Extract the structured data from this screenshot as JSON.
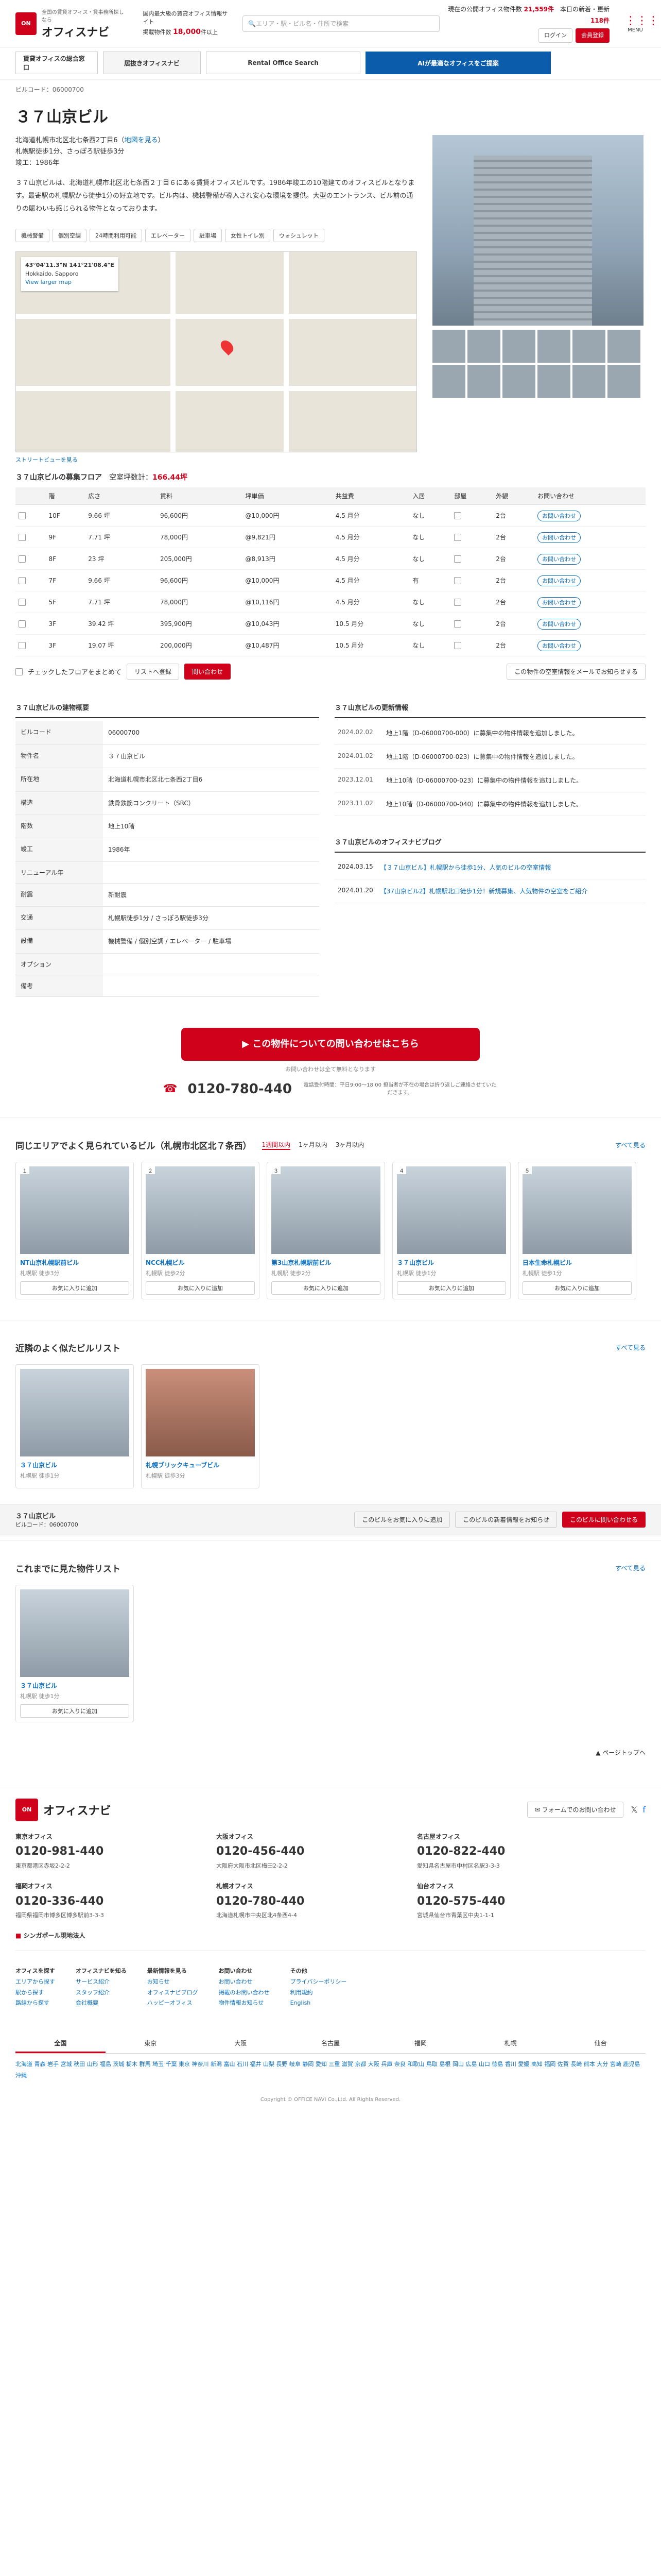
{
  "header": {
    "logo_sub": "全国の賃貸オフィス・貸事務所探しなら",
    "logo": "オフィスナビ",
    "tag1": "国内最大級の賃貸オフィス情報サイト",
    "tag2": "掲載物件数",
    "count": "18,000",
    "count_unit": "件以上",
    "search_ph": "エリア・駅・ビル名・住所で検索",
    "r1": "現在の公開オフィス物件数",
    "r1v": "21,559件",
    "r2": "本日の新着・更新",
    "r2v": "118件",
    "login": "ログイン",
    "register": "会員登録",
    "menu": "MENU"
  },
  "banners": [
    "賃貸オフィスの総合窓口",
    "居抜きオフィスナビ",
    "Rental Office Search",
    "AIが最適なオフィスをご提案"
  ],
  "crumb": "ビルコード：06000700",
  "title": "３７山京ビル",
  "addr": [
    "北海道札幌市北区北七条西2丁目6",
    "札幌駅徒歩1分、さっぽろ駅徒歩3分",
    "竣工：1986年"
  ],
  "addr_link": "地図を見る",
  "desc": "３７山京ビルは、北海道札幌市北区北七条西２丁目６にある賃貸オフィスビルです。1986年竣工の10階建てのオフィスビルとなります。最寄駅の札幌駅から徒歩1分の好立地です。ビル内は、機械警備が導入され安心な環境を提供。大型のエントランス、ビル前の通りの賑わいも感じられる物件となっております。",
  "tags": [
    "機械警備",
    "個別空調",
    "24時間利用可能",
    "エレベーター",
    "駐車場",
    "女性トイレ別",
    "ウォシュレット"
  ],
  "map": {
    "coords": "43°04'11.3\"N 141°21'08.4\"E",
    "place": "Hokkaido, Sapporo",
    "link": "View larger map",
    "note": "ストリートビューを見る"
  },
  "avail": {
    "title": "３７山京ビルの募集フロア",
    "total_label": "空室坪数計：",
    "total": "166.44坪",
    "cols": [
      "",
      "階",
      "広さ",
      "賃料",
      "坪単価",
      "共益費",
      "入居",
      "部屋",
      "外観",
      "お問い合わせ"
    ],
    "rows": [
      [
        "10F",
        "9.66 坪",
        "96,600円",
        "@10,000円",
        "4.5 月分",
        "なし",
        "2台",
        "お問い合わせ"
      ],
      [
        "9F",
        "7.71 坪",
        "78,000円",
        "@9,821円",
        "4.5 月分",
        "なし",
        "2台",
        "お問い合わせ"
      ],
      [
        "8F",
        "23 坪",
        "205,000円",
        "@8,913円",
        "4.5 月分",
        "なし",
        "2台",
        "お問い合わせ"
      ],
      [
        "7F",
        "9.66 坪",
        "96,600円",
        "@10,000円",
        "4.5 月分",
        "有",
        "2台",
        "お問い合わせ"
      ],
      [
        "5F",
        "7.71 坪",
        "78,000円",
        "@10,116円",
        "4.5 月分",
        "なし",
        "2台",
        "お問い合わせ"
      ],
      [
        "3F",
        "39.42 坪",
        "395,900円",
        "@10,043円",
        "10.5 月分",
        "なし",
        "2台",
        "お問い合わせ"
      ],
      [
        "3F",
        "19.07 坪",
        "200,000円",
        "@10,487円",
        "10.5 月分",
        "なし",
        "2台",
        "お問い合わせ"
      ]
    ]
  },
  "actions": {
    "check": "チェックしたフロアをまとめて",
    "btn1": "リストへ登録",
    "btn2": "問い合わせ",
    "right": "この物件の空室情報をメールでお知らせする"
  },
  "detail": {
    "title": "３７山京ビルの建物概要",
    "rows": [
      [
        "ビルコード",
        "06000700"
      ],
      [
        "物件名",
        "３７山京ビル"
      ],
      [
        "所在地",
        "北海道札幌市北区北七条西2丁目6"
      ],
      [
        "構造",
        "鉄骨鉄筋コンクリート（SRC）"
      ],
      [
        "階数",
        "地上10階"
      ],
      [
        "竣工",
        "1986年"
      ],
      [
        "リニューアル年",
        ""
      ],
      [
        "耐震",
        "新耐震"
      ],
      [
        "交通",
        "札幌駅徒歩1分 / さっぽろ駅徒歩3分"
      ],
      [
        "設備",
        "機械警備 / 個別空調 / エレベーター / 駐車場"
      ],
      [
        "オプション",
        ""
      ],
      [
        "備考",
        ""
      ]
    ]
  },
  "history": {
    "title": "３７山京ビルの更新情報",
    "rows": [
      [
        "2024.02.02",
        "地上1階（D-06000700-000）に募集中の物件情報を追加しました。"
      ],
      [
        "2024.01.02",
        "地上1階（D-06000700-023）に募集中の物件情報を追加しました。"
      ],
      [
        "2023.12.01",
        "地上10階（D-06000700-023）に募集中の物件情報を追加しました。"
      ],
      [
        "2023.11.02",
        "地上10階（D-06000700-040）に募集中の物件情報を追加しました。"
      ]
    ]
  },
  "blog": {
    "title": "３７山京ビルのオフィスナビブログ",
    "rows": [
      [
        "2024.03.15",
        "【３７山京ビル】札幌駅から徒歩1分、人気のビルの空室情報"
      ],
      [
        "2024.01.20",
        "【37山京ビル2】札幌駅北口徒歩1分！新規募集、人気物件の空室をご紹介"
      ]
    ]
  },
  "cta": {
    "btn": "この物件についての問い合わせはこちら",
    "note": "お問い合わせは全て無料となります",
    "tel": "0120-780-440",
    "tel_note": "電話受付時間：平日9:00〜18:00 担当者が不在の場合は折り返しご連絡させていただきます。"
  },
  "nearby": {
    "title": "同じエリアでよく見られているビル（札幌市北区北７条西）",
    "tabs": [
      "1週間以内",
      "1ヶ月以内",
      "3ヶ月以内"
    ],
    "see": "すべて見る",
    "cards": [
      [
        "１",
        "NT山京札幌駅前ビル",
        "札幌駅 徒歩3分"
      ],
      [
        "２",
        "NCC札幌ビル",
        "札幌駅 徒歩2分"
      ],
      [
        "３",
        "第3山京札幌駅前ビル",
        "札幌駅 徒歩2分"
      ],
      [
        "４",
        "３７山京ビル",
        "札幌駅 徒歩1分"
      ],
      [
        "５",
        "日本生命札幌ビル",
        "札幌駅 徒歩1分"
      ]
    ],
    "btn": "お気に入りに追加"
  },
  "similar": {
    "title": "近隣のよく似たビルリスト",
    "see": "すべて見る",
    "cards": [
      [
        "３７山京ビル",
        "札幌駅 徒歩1分"
      ],
      [
        "札幌ブリックキューブビル",
        "札幌駅 徒歩3分"
      ]
    ]
  },
  "stickybar": {
    "name": "３７山京ビル",
    "code": "ビルコード：06000700",
    "b1": "このビルをお気に入りに追加",
    "b2": "このビルの新着情報をお知らせ",
    "b3": "このビルに問い合わせる"
  },
  "recent": {
    "title": "これまでに見た物件リスト",
    "see": "すべて見る",
    "card": [
      "３７山京ビル",
      "札幌駅 徒歩1分"
    ],
    "btn": "お気に入りに追加"
  },
  "pagetop": "ページトップへ",
  "footer_form": "フォームでのお問い合わせ",
  "offices": [
    [
      "東京オフィス",
      "0120-981-440",
      "東京都港区赤坂2-2-2"
    ],
    [
      "大阪オフィス",
      "0120-456-440",
      "大阪府大阪市北区梅田2-2-2"
    ],
    [
      "名古屋オフィス",
      "0120-822-440",
      "愛知県名古屋市中村区名駅3-3-3"
    ],
    [
      "福岡オフィス",
      "0120-336-440",
      "福岡県福岡市博多区博多駅前3-3-3"
    ],
    [
      "札幌オフィス",
      "0120-780-440",
      "北海道札幌市中央区北4条西4-4"
    ],
    [
      "仙台オフィス",
      "0120-575-440",
      "宮城県仙台市青葉区中央1-1-1"
    ]
  ],
  "singapore": "シンガポール現地法人",
  "flinks": [
    [
      "オフィスを探す",
      "エリアから探す",
      "駅から探す",
      "路線から探す"
    ],
    [
      "オフィスナビを知る",
      "サービス紹介",
      "スタッフ紹介",
      "会社概要"
    ],
    [
      "最新情報を見る",
      "お知らせ",
      "オフィスナビブログ",
      "ハッピーオフィス"
    ],
    [
      "お問い合わせ",
      "お問い合わせ",
      "掲載のお問い合わせ",
      "物件情報お知らせ"
    ],
    [
      "その他",
      "プライバシーポリシー",
      "利用規約",
      "English"
    ]
  ],
  "area_tabs": [
    "全国",
    "東京",
    "大阪",
    "名古屋",
    "福岡",
    "札幌",
    "仙台"
  ],
  "areas": "北海道 青森 岩手 宮城 秋田 山形 福島 茨城 栃木 群馬 埼玉 千葉 東京 神奈川 新潟 富山 石川 福井 山梨 長野 岐阜 静岡 愛知 三重 滋賀 京都 大阪 兵庫 奈良 和歌山 鳥取 島根 岡山 広島 山口 徳島 香川 愛媛 高知 福岡 佐賀 長崎 熊本 大分 宮崎 鹿児島 沖縄",
  "copy": "Copyright © OFFICE NAVI Co.,Ltd. All Rights Reserved."
}
